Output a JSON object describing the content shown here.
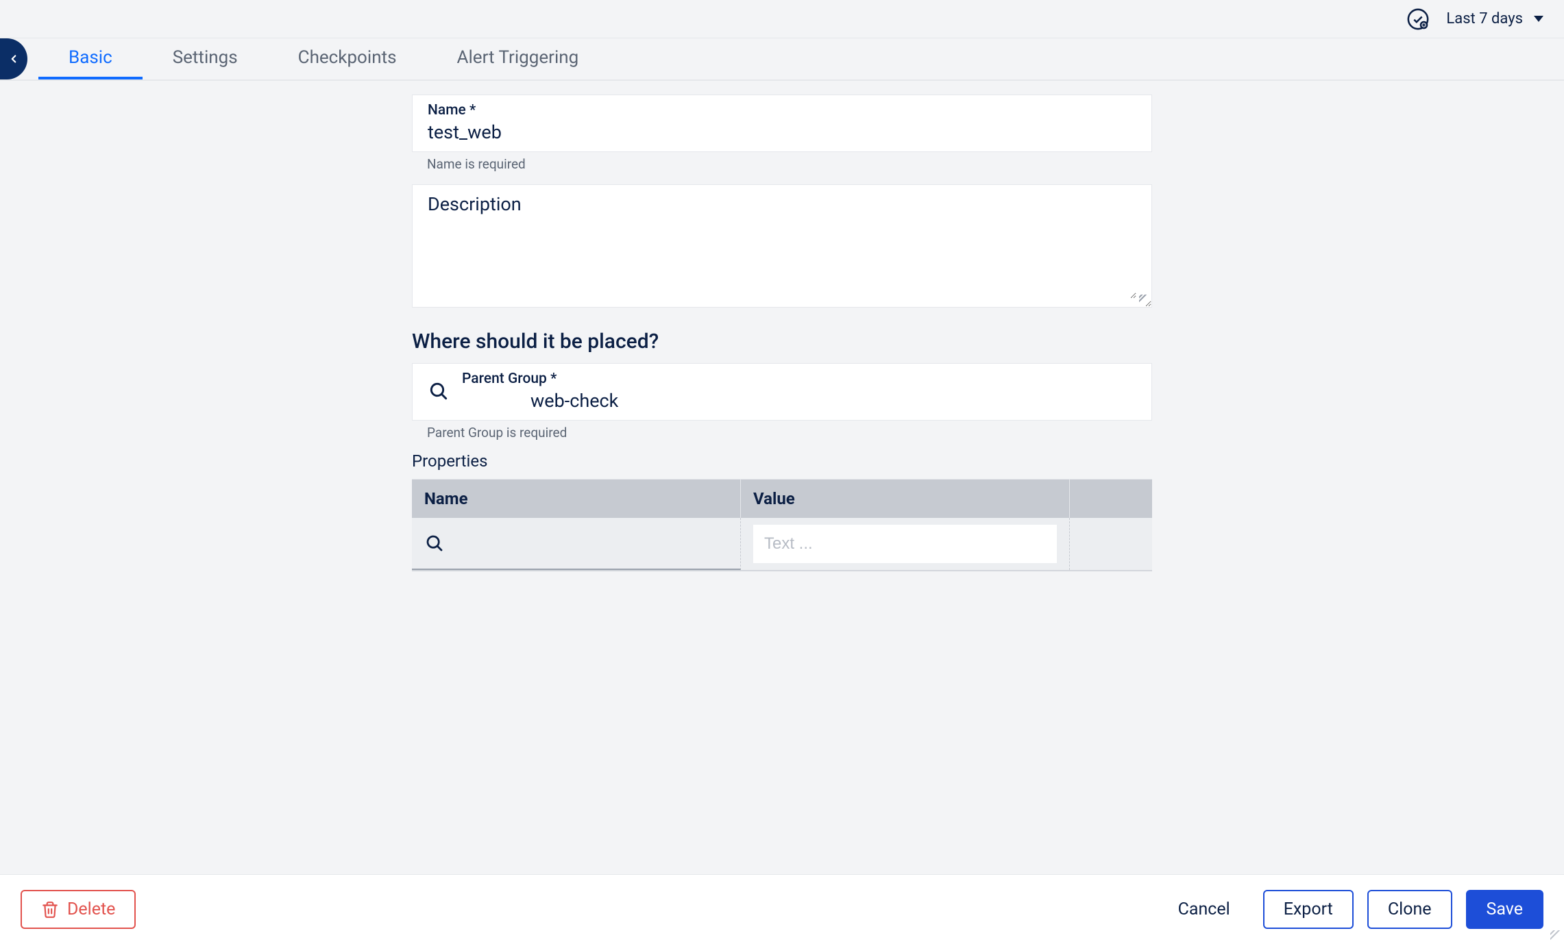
{
  "topbar": {
    "time_range": "Last 7 days"
  },
  "tabs": [
    {
      "label": "Basic",
      "active": true
    },
    {
      "label": "Settings",
      "active": false
    },
    {
      "label": "Checkpoints",
      "active": false
    },
    {
      "label": "Alert Triggering",
      "active": false
    }
  ],
  "form": {
    "name_label": "Name *",
    "name_value": "test_web",
    "name_helper": "Name is required",
    "description_label": "Description",
    "description_value": "",
    "placement_heading": "Where should it be placed?",
    "parent_group_label": "Parent Group *",
    "parent_group_value": "web-check",
    "parent_group_helper": "Parent Group is required",
    "properties_label": "Properties",
    "properties_headers": {
      "name": "Name",
      "value": "Value"
    },
    "properties_value_placeholder": "Text ..."
  },
  "footer": {
    "delete": "Delete",
    "cancel": "Cancel",
    "export": "Export",
    "clone": "Clone",
    "save": "Save"
  }
}
